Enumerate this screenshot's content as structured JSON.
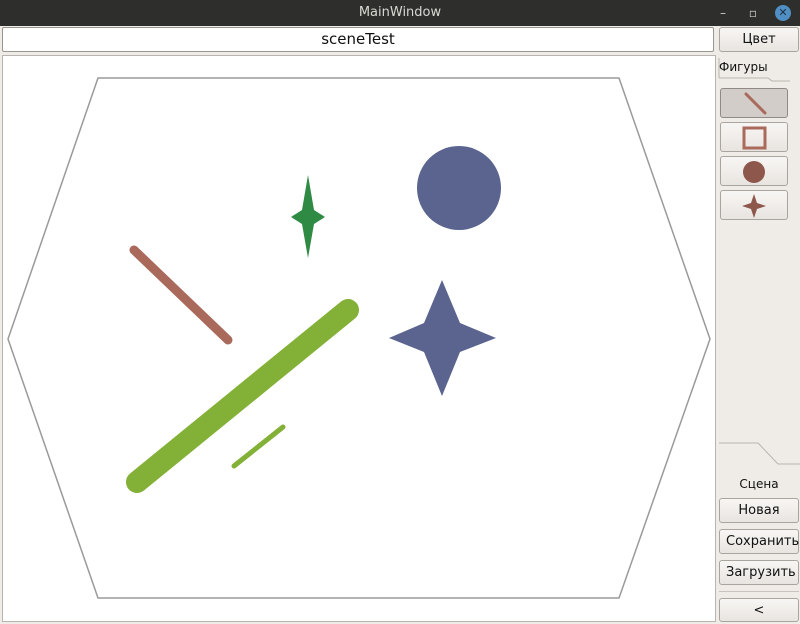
{
  "window": {
    "title": "MainWindow",
    "buttons": {
      "minimize": "–",
      "maximize": "▫",
      "close": "✕"
    }
  },
  "scene_name": {
    "value": "sceneTest"
  },
  "toolbar": {
    "color_label": "Цвет",
    "figures_tab_label": "Фигуры",
    "tools": [
      {
        "name": "line",
        "active": true
      },
      {
        "name": "rectangle",
        "active": false
      },
      {
        "name": "ellipse",
        "active": false
      },
      {
        "name": "star",
        "active": false
      }
    ]
  },
  "scene_panel": {
    "label": "Сцена",
    "new_label": "Новая",
    "save_label": "Сохранить",
    "load_label": "Загрузить",
    "collapse_label": "<"
  },
  "colors": {
    "brown": "#a9695b",
    "slate_blue": "#5a648f",
    "dark_green": "#2f8a44",
    "olive_green": "#83b036",
    "border_gray": "#9a9a9a",
    "tool_icon": "#9a5a4e"
  }
}
